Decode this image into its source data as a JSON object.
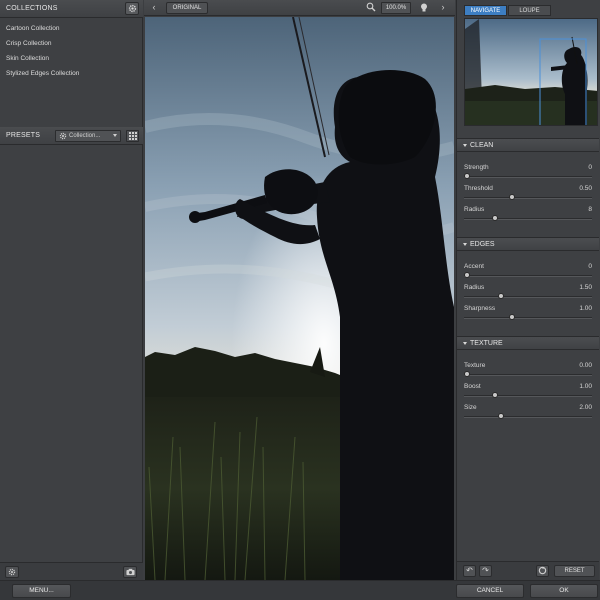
{
  "collections": {
    "title": "COLLECTIONS",
    "items": [
      "Cartoon Collection",
      "Crisp Collection",
      "Skin Collection",
      "Stylized Edges Collection"
    ]
  },
  "presets": {
    "title": "PRESETS",
    "select_label": "Collection..."
  },
  "viewer": {
    "original_label": "ORIGINAL",
    "zoom": "100.0%"
  },
  "tabs": {
    "navigate": "NAVIGATE",
    "loupe": "LOUPE"
  },
  "sections": [
    {
      "title": "CLEAN",
      "sliders": [
        {
          "label": "Strength",
          "value": "0",
          "pos": 0.0
        },
        {
          "label": "Threshold",
          "value": "0.50",
          "pos": 0.37
        },
        {
          "label": "Radius",
          "value": "8",
          "pos": 0.23
        }
      ]
    },
    {
      "title": "EDGES",
      "sliders": [
        {
          "label": "Accent",
          "value": "0",
          "pos": 0.0
        },
        {
          "label": "Radius",
          "value": "1.50",
          "pos": 0.28
        },
        {
          "label": "Sharpness",
          "value": "1.00",
          "pos": 0.37
        }
      ]
    },
    {
      "title": "TEXTURE",
      "sliders": [
        {
          "label": "Texture",
          "value": "0.00",
          "pos": 0.0
        },
        {
          "label": "Boost",
          "value": "1.00",
          "pos": 0.23
        },
        {
          "label": "Size",
          "value": "2.00",
          "pos": 0.28
        }
      ]
    }
  ],
  "footer": {
    "reset": "RESET",
    "menu": "MENU...",
    "cancel": "CANCEL",
    "ok": "OK"
  },
  "colors": {
    "accent": "#3d7ec2",
    "panel": "#3e4043"
  }
}
